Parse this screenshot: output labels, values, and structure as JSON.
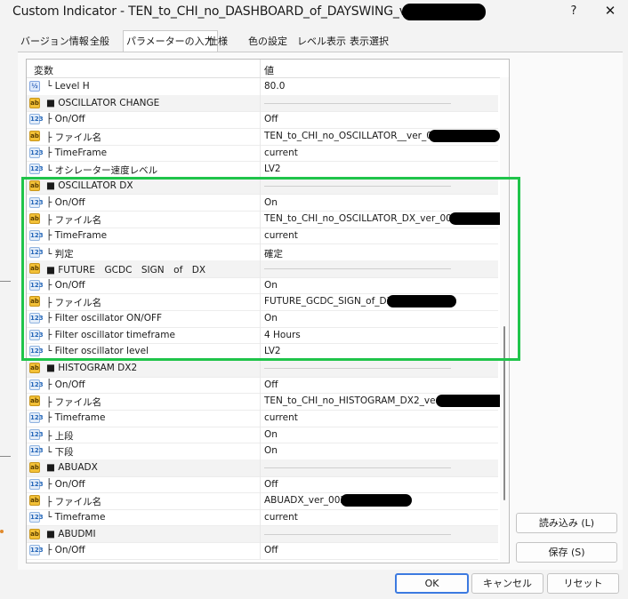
{
  "window": {
    "title": "Custom Indicator - TEN_to_CHI_no_DASHBOARD_of_DAYSWING_ver_3_",
    "help": "?",
    "close": "✕"
  },
  "tabs": [
    "バージョン情報",
    "全般",
    "パラメーターの入力",
    "仕様",
    "色の設定",
    "レベル表示",
    "表示選択"
  ],
  "active_tab": "パラメーターの入力",
  "table": {
    "col_name": "変数",
    "col_value": "値",
    "rows": [
      {
        "icon": "vz",
        "name": "└ Level H",
        "value": "80.0",
        "group": false
      },
      {
        "icon": "ab",
        "name": "■ OSCILLATOR CHANGE",
        "value": "",
        "group": true
      },
      {
        "icon": "123",
        "name": "├ On/Off",
        "value": "Off",
        "group": false
      },
      {
        "icon": "ab",
        "name": "├ ファイル名",
        "value": "TEN_to_CHI_no_OSCILLATOR__ver_005",
        "group": false
      },
      {
        "icon": "123",
        "name": "├ TimeFrame",
        "value": "current",
        "group": false
      },
      {
        "icon": "123",
        "name": "└ オシレーター速度レベル",
        "value": "LV2",
        "group": false
      },
      {
        "icon": "ab",
        "name": "■ OSCILLATOR DX",
        "value": "",
        "group": true
      },
      {
        "icon": "123",
        "name": "├ On/Off",
        "value": "On",
        "group": false
      },
      {
        "icon": "ab",
        "name": "├ ファイル名",
        "value": "TEN_to_CHI_no_OSCILLATOR_DX_ver_003_1",
        "group": false
      },
      {
        "icon": "123",
        "name": "├ TimeFrame",
        "value": "current",
        "group": false
      },
      {
        "icon": "123",
        "name": "└ 判定",
        "value": "確定",
        "group": false
      },
      {
        "icon": "ab",
        "name": "■ FUTURE　GCDC　SIGN　of　DX",
        "value": "",
        "group": true
      },
      {
        "icon": "123",
        "name": "├ On/Off",
        "value": "On",
        "group": false
      },
      {
        "icon": "ab",
        "name": "├ ファイル名",
        "value": "FUTURE_GCDC_SIGN_of_DX_",
        "group": false
      },
      {
        "icon": "123",
        "name": "├ Filter oscillator ON/OFF",
        "value": "On",
        "group": false
      },
      {
        "icon": "123",
        "name": "├ Filter oscillator timeframe",
        "value": "4 Hours",
        "group": false
      },
      {
        "icon": "123",
        "name": "└ Filter oscillator level",
        "value": "LV2",
        "group": false
      },
      {
        "icon": "ab",
        "name": "■ HISTOGRAM DX2",
        "value": "",
        "group": true
      },
      {
        "icon": "123",
        "name": "├ On/Off",
        "value": "Off",
        "group": false
      },
      {
        "icon": "ab",
        "name": "├ ファイル名",
        "value": "TEN_to_CHI_no_HISTOGRAM_DX2_ver2_",
        "group": false
      },
      {
        "icon": "123",
        "name": "├ Timeframe",
        "value": "current",
        "group": false
      },
      {
        "icon": "123",
        "name": "├ 上段",
        "value": "On",
        "group": false
      },
      {
        "icon": "123",
        "name": "└ 下段",
        "value": "On",
        "group": false
      },
      {
        "icon": "ab",
        "name": "■ ABUADX",
        "value": "",
        "group": true
      },
      {
        "icon": "123",
        "name": "├ On/Off",
        "value": "Off",
        "group": false
      },
      {
        "icon": "ab",
        "name": "├ ファイル名",
        "value": "ABUADX_ver_002_",
        "group": false
      },
      {
        "icon": "123",
        "name": "└ Timeframe",
        "value": "current",
        "group": false
      },
      {
        "icon": "ab",
        "name": "■ ABUDMI",
        "value": "",
        "group": true
      },
      {
        "icon": "123",
        "name": "├ On/Off",
        "value": "Off",
        "group": false
      }
    ]
  },
  "buttons": {
    "load": "読み込み (L)",
    "save": "保存 (S)",
    "ok": "OK",
    "cancel": "キャンセル",
    "reset": "リセット"
  }
}
